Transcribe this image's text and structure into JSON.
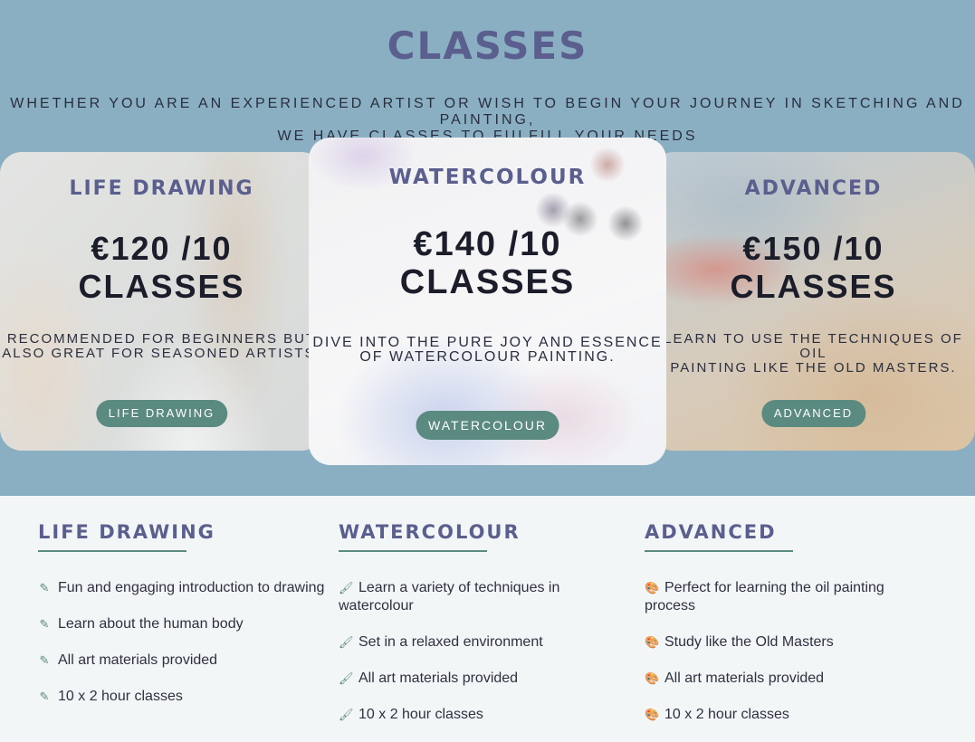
{
  "header": {
    "title": "CLASSES",
    "subtitle_line1": "WHETHER YOU ARE AN EXPERIENCED ARTIST OR WISH TO BEGIN YOUR JOURNEY IN SKETCHING AND PAINTING,",
    "subtitle_line2": "WE HAVE CLASSES TO FULFILL YOUR NEEDS"
  },
  "cards": [
    {
      "title": "LIFE DRAWING",
      "price_line1": "€120 /10",
      "price_line2": "CLASSES",
      "desc_line1": "RECOMMENDED FOR BEGINNERS BUT",
      "desc_line2": "ALSO GREAT FOR SEASONED ARTISTS.",
      "button": "LIFE DRAWING"
    },
    {
      "title": "WATERCOLOUR",
      "price_line1": "€140 /10",
      "price_line2": "CLASSES",
      "desc_line1": "DIVE INTO THE PURE JOY AND ESSENCE",
      "desc_line2": "OF WATERCOLOUR PAINTING.",
      "button": "WATERCOLOUR"
    },
    {
      "title": "ADVANCED",
      "price_line1": "€150 /10",
      "price_line2": "CLASSES",
      "desc_line1": "LEARN TO USE THE TECHNIQUES OF OIL",
      "desc_line2": "PAINTING LIKE THE OLD MASTERS.",
      "button": "ADVANCED"
    }
  ],
  "details": [
    {
      "title": "LIFE DRAWING",
      "icon": "pencil-icon",
      "items": [
        "Fun and engaging introduction to drawing",
        "Learn about the human body",
        "All art materials provided",
        "10 x 2 hour classes"
      ]
    },
    {
      "title": "WATERCOLOUR",
      "icon": "brush-icon",
      "items": [
        "Learn a variety of techniques in watercolour",
        "Set in a relaxed environment",
        "All art materials provided",
        "10 x 2 hour classes"
      ]
    },
    {
      "title": "ADVANCED",
      "icon": "palette-icon",
      "items": [
        "Perfect for learning the oil painting process",
        "Study like the Old Masters",
        "All art materials provided",
        "10 x 2 hour classes"
      ]
    }
  ],
  "colors": {
    "hero_bg": "#8aafc2",
    "accent_green": "#5b8a80",
    "title_purple": "#5b5f8e",
    "page_bg": "#f3f6f7"
  }
}
